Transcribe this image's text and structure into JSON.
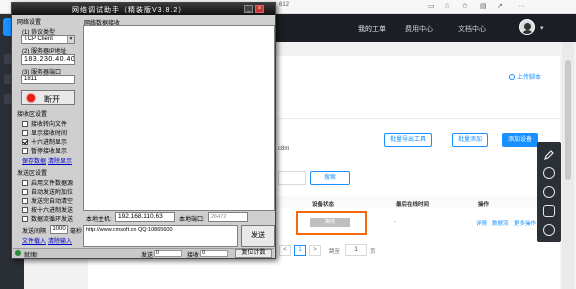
{
  "browser": {
    "address_partial": "612",
    "icons": [
      "tab-icon",
      "star-icon",
      "favorites-icon",
      "collections-icon",
      "share-icon",
      "menu-icon"
    ]
  },
  "site": {
    "nav": {
      "my_ticket": "我的工单",
      "fees": "费用中心",
      "docs": "文档中心"
    },
    "upload_script": "上传脚本",
    "buttons": {
      "batch_export": "批量导出工具",
      "batch_add": "批量添加",
      "add_device": "添加设备"
    },
    "partial_id": "c8m",
    "search": "搜索",
    "table_headers": {
      "status": "设备状态",
      "last_online": "最后在线时间",
      "ops": "操作"
    },
    "row": {
      "status": "离线",
      "last_online": "-",
      "op_detail": "详情",
      "op_data": "数据流",
      "op_more": "更多操作"
    },
    "pager": {
      "prev": "<",
      "page": "1",
      "next": ">",
      "goto": "跳至",
      "page_input": "1",
      "page_unit": "页"
    },
    "colors": {
      "accent": "#1890ff",
      "highlight": "#f5680b",
      "nav_bg": "#1b1f25"
    }
  },
  "tool": {
    "title": "网络调试助手（精装版V3.8.2）",
    "net_settings": "网络设置",
    "protocol_label": "(1) 协议类型",
    "protocol_value": "TCP Client",
    "server_ip_label": "(2) 服务器IP地址",
    "server_ip_value": "183.230.40.40",
    "server_port_label": "(3) 服务器端口",
    "server_port_value": "1811",
    "open_btn": "断开",
    "recv_settings": "接收区设置",
    "recv_opts": [
      {
        "label": "接收转向文件",
        "checked": false
      },
      {
        "label": "显示接收时间",
        "checked": false
      },
      {
        "label": "十六进制显示",
        "checked": true
      },
      {
        "label": "暂停接收显示",
        "checked": false
      }
    ],
    "recv_links": {
      "save": "保存数据",
      "clear": "清除显示"
    },
    "send_settings": "发送区设置",
    "send_opts": [
      {
        "label": "启用文件数据源",
        "checked": false
      },
      {
        "label": "自动发送附加位",
        "checked": false
      },
      {
        "label": "发送完自动清空",
        "checked": false
      },
      {
        "label": "按十六进制发送",
        "checked": false
      },
      {
        "label": "数据流循环发送",
        "checked": false
      }
    ],
    "interval_label": "发送间隔",
    "interval_value": "1000",
    "interval_unit": "毫秒",
    "send_links": {
      "load": "文件载入",
      "clear": "清除输入"
    },
    "recv_area_label": "网络数据接收",
    "local_host_label": "本地主机:",
    "local_host_value": "192.168.110.63",
    "local_port_label": "本地端口:",
    "local_port_value": "26472",
    "send_text": "http://www.cmsoft.cn QQ:10865600",
    "send_btn": "发送",
    "status": {
      "ready": "就绪!",
      "sent_label": "发送",
      "sent_value": "0",
      "recv_label": "接收",
      "recv_value": "0",
      "reset": "复位计数"
    }
  }
}
